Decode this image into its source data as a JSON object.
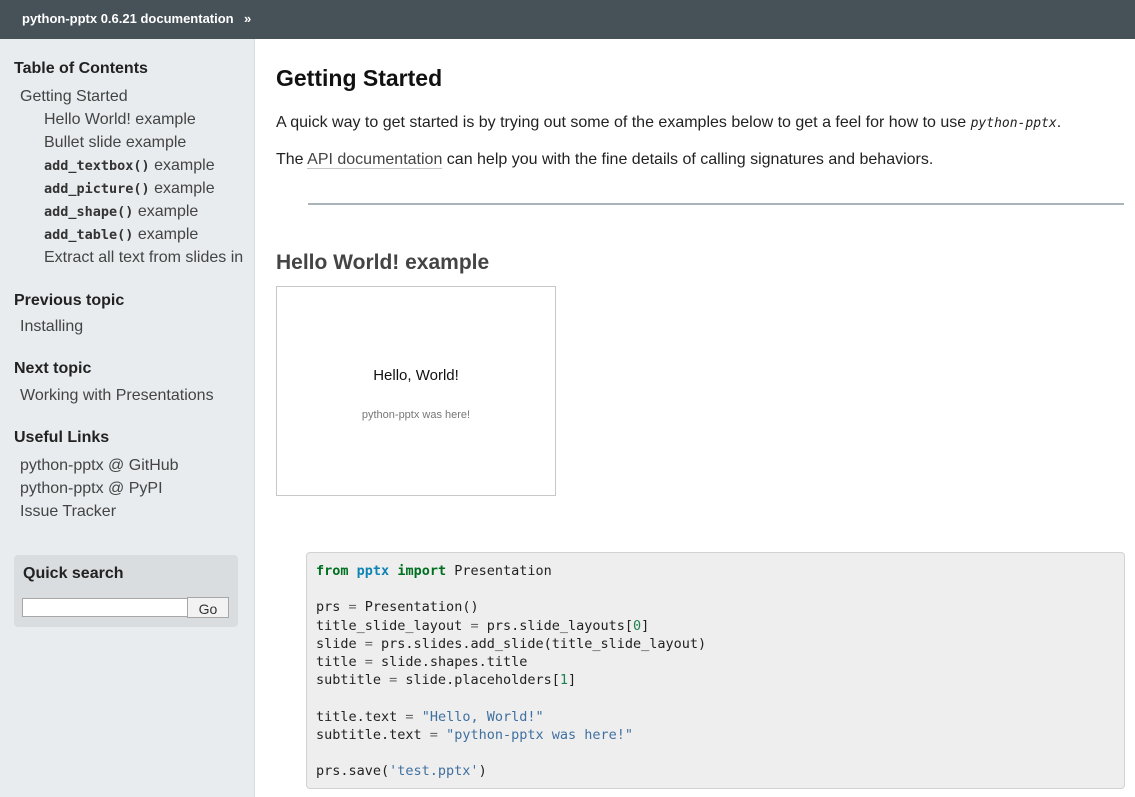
{
  "header": {
    "home_label": "python-pptx 0.6.21 documentation",
    "separator": "»"
  },
  "sidebar": {
    "toc_heading": "Table of Contents",
    "toc": [
      {
        "level": 1,
        "code": "",
        "text": "Getting Started"
      },
      {
        "level": 2,
        "code": "",
        "text": "Hello World! example"
      },
      {
        "level": 2,
        "code": "",
        "text": "Bullet slide example"
      },
      {
        "level": 2,
        "code": "add_textbox()",
        "text": " example"
      },
      {
        "level": 2,
        "code": "add_picture()",
        "text": " example"
      },
      {
        "level": 2,
        "code": "add_shape()",
        "text": " example"
      },
      {
        "level": 2,
        "code": "add_table()",
        "text": " example"
      },
      {
        "level": 2,
        "code": "",
        "text": "Extract all text from slides in"
      }
    ],
    "prev_heading": "Previous topic",
    "prev_link": "Installing",
    "next_heading": "Next topic",
    "next_link": "Working with Presentations",
    "links_heading": "Useful Links",
    "useful_links": [
      "python-pptx @ GitHub",
      "python-pptx @ PyPI",
      "Issue Tracker"
    ],
    "search": {
      "heading": "Quick search",
      "input_value": "",
      "go_label": "Go"
    }
  },
  "main": {
    "title": "Getting Started",
    "intro_text": "A quick way to get started is by trying out some of the examples below to get a feel for how to use ",
    "intro_pkg": "python-pptx",
    "intro_end": ".",
    "api_prefix": "The ",
    "api_link": "API documentation",
    "api_suffix": " can help you with the fine details of calling signatures and behaviors.",
    "section_title": "Hello World! example",
    "slide": {
      "title": "Hello, World!",
      "subtitle": "python-pptx was here!"
    },
    "code_lines": [
      [
        [
          "kw",
          "from"
        ],
        [
          "t",
          " "
        ],
        [
          "mod",
          "pptx"
        ],
        [
          "t",
          " "
        ],
        [
          "kw",
          "import"
        ],
        [
          "t",
          " Presentation"
        ]
      ],
      [],
      [
        [
          "t",
          "prs "
        ],
        [
          "op",
          "="
        ],
        [
          "t",
          " Presentation()"
        ]
      ],
      [
        [
          "t",
          "title_slide_layout "
        ],
        [
          "op",
          "="
        ],
        [
          "t",
          " prs.slide_layouts["
        ],
        [
          "num",
          "0"
        ],
        [
          "t",
          "]"
        ]
      ],
      [
        [
          "t",
          "slide "
        ],
        [
          "op",
          "="
        ],
        [
          "t",
          " prs.slides.add_slide(title_slide_layout)"
        ]
      ],
      [
        [
          "t",
          "title "
        ],
        [
          "op",
          "="
        ],
        [
          "t",
          " slide.shapes.title"
        ]
      ],
      [
        [
          "t",
          "subtitle "
        ],
        [
          "op",
          "="
        ],
        [
          "t",
          " slide.placeholders["
        ],
        [
          "num",
          "1"
        ],
        [
          "t",
          "]"
        ]
      ],
      [],
      [
        [
          "t",
          "title.text "
        ],
        [
          "op",
          "="
        ],
        [
          "t",
          " "
        ],
        [
          "str",
          "\"Hello, World!\""
        ]
      ],
      [
        [
          "t",
          "subtitle.text "
        ],
        [
          "op",
          "="
        ],
        [
          "t",
          " "
        ],
        [
          "str",
          "\"python-pptx was here!\""
        ]
      ],
      [],
      [
        [
          "t",
          "prs.save("
        ],
        [
          "str",
          "'test.pptx'"
        ],
        [
          "t",
          ")"
        ]
      ]
    ]
  }
}
